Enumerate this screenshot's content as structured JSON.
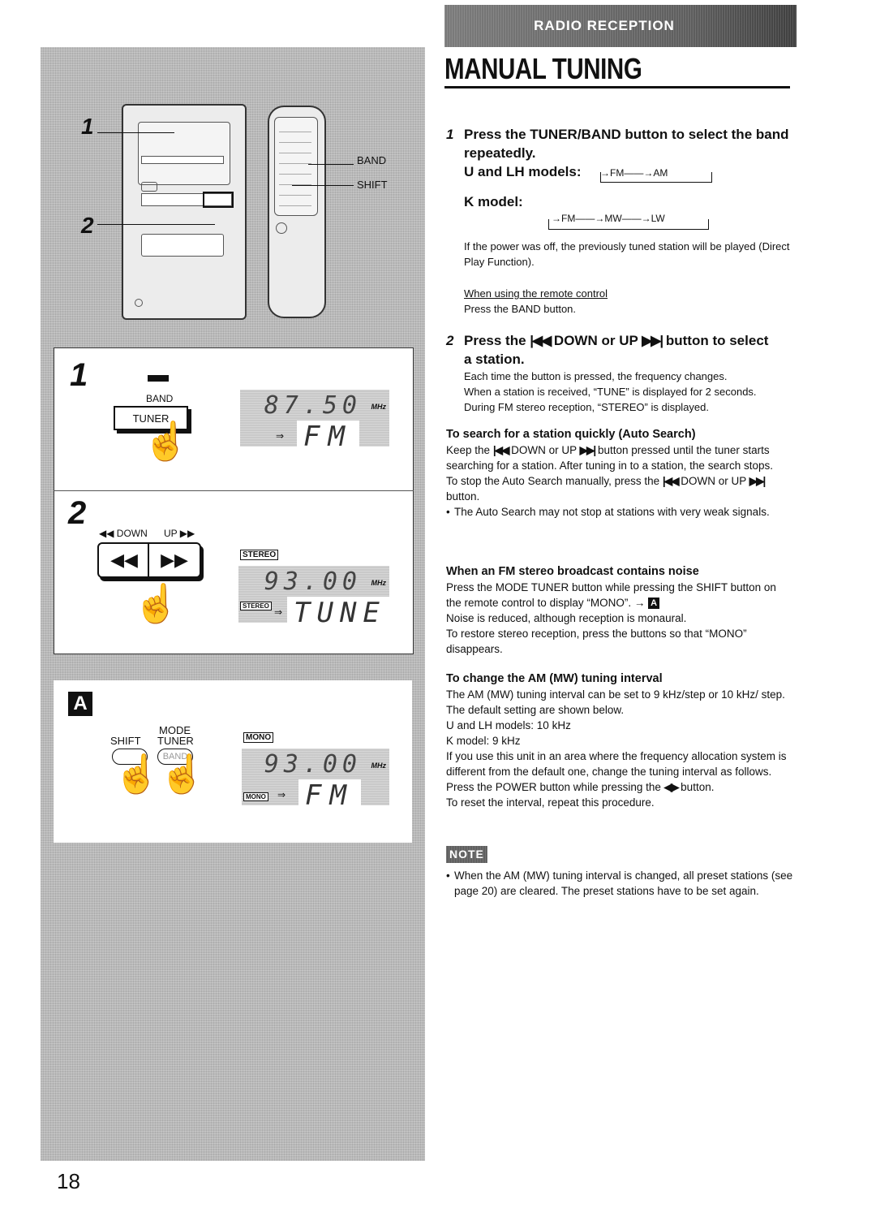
{
  "header": {
    "section_banner": "RADIO RECEPTION",
    "title": "MANUAL TUNING"
  },
  "page_number": "18",
  "illustration": {
    "callouts": [
      "1",
      "2"
    ],
    "remote_labels": [
      "BAND",
      "SHIFT"
    ],
    "step1": {
      "number": "1",
      "button_label_top": "BAND",
      "button_label": "TUNER",
      "display_freq": "87.50",
      "display_unit": "MHz",
      "display_mode": "FM",
      "display_arrow": "⇒"
    },
    "step2": {
      "number": "2",
      "down_label": "◀◀ DOWN",
      "up_label": "UP ▶▶",
      "down_symbol": "◀◀",
      "up_symbol": "▶▶",
      "indicator": "STEREO",
      "display_freq": "93.00",
      "display_unit": "MHz",
      "display_mode": "TUNE",
      "display_arrow": "⇒"
    },
    "stepA": {
      "badge": "A",
      "shift_label": "SHIFT",
      "mode_label_1": "MODE",
      "mode_label_2": "TUNER",
      "band_label": "BAND",
      "indicator": "MONO",
      "display_freq": "93.00",
      "display_unit": "MHz",
      "display_mode": "FM",
      "display_arrow": "⇒"
    }
  },
  "steps": [
    {
      "number": "1",
      "heading_line1": "Press the TUNER/BAND button to select the band",
      "heading_line2": "repeatedly.",
      "u_lh_label": "U and LH models:",
      "u_lh_cycle": "→FM——→AM",
      "k_label": "K model:",
      "k_cycle": "→FM——→MW——→LW",
      "body": "If the power was off, the previously tuned station will be played (Direct Play Function).",
      "remote_heading": "When using the remote control",
      "remote_body": "Press the BAND button."
    },
    {
      "number": "2",
      "heading_prefix": "Press the",
      "heading_down_symbol": "|◀◀",
      "heading_middle": "DOWN or UP",
      "heading_up_symbol": "▶▶|",
      "heading_suffix": "button to select",
      "heading_line2": "a station.",
      "body": [
        "Each time the button is pressed, the frequency changes.",
        "When a station is received, “TUNE” is displayed for 2 seconds.",
        "During FM stereo reception, “STEREO” is displayed."
      ]
    }
  ],
  "auto_search": {
    "heading": "To search for a station quickly (Auto Search)",
    "p1_pre": "Keep the",
    "p1_mid": "DOWN or UP",
    "p1_post": "button pressed until the tuner starts searching for a station.  After tuning in to a station, the search stops.",
    "p2_pre": "To stop the Auto Search manually, press the",
    "p2_mid": "DOWN or UP",
    "p2_post": "button.",
    "bullet": "The Auto Search may not stop at stations with very weak signals.",
    "down_symbol": "|◀◀",
    "up_symbol": "▶▶|"
  },
  "fm_noise": {
    "heading": "When an FM stereo broadcast contains noise",
    "p1": "Press the MODE TUNER button while pressing the SHIFT button on the remote control to display “MONO”. →",
    "ref_badge": "A",
    "p2": "Noise is reduced, although reception is monaural.",
    "p3": "To restore stereo reception, press the buttons so that “MONO” disappears."
  },
  "am_interval": {
    "heading": "To change the AM (MW) tuning interval",
    "p1": "The AM (MW) tuning interval can be set to 9 kHz/step or 10 kHz/ step. The default setting are shown below.",
    "u_lh": "U and LH models:  10 kHz",
    "k": "K model:  9 kHz",
    "p2": "If you use this unit in an area where the frequency allocation system is different from the default one, change the tuning interval as follows.",
    "p3_pre": "Press the POWER button while pressing the",
    "p3_symbol": "◀▶",
    "p3_post": "button.",
    "p4": "To reset the interval, repeat this procedure."
  },
  "note": {
    "label": "NOTE",
    "bullet": "When the AM (MW) tuning interval is changed, all preset stations (see page 20) are cleared.  The preset stations have to be set again."
  }
}
